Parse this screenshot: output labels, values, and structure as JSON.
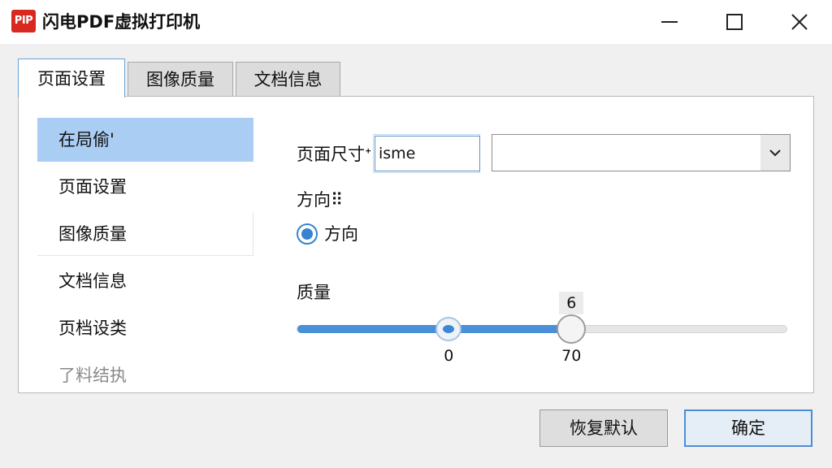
{
  "app": {
    "icon_text": "PIP",
    "title": "闪电PDF虚拟打印机",
    "brand_color": "#d8281f"
  },
  "window_controls": [
    "minimize-icon",
    "maximize-icon",
    "close-icon"
  ],
  "tabs": [
    {
      "label": "页面设置",
      "active": true
    },
    {
      "label": "图像质量",
      "active": false
    },
    {
      "label": "文档信息",
      "active": false
    }
  ],
  "sidebar": {
    "items": [
      {
        "label": "在局偷'",
        "selected": true
      },
      {
        "label": "页面设置"
      },
      {
        "label": "图像质量"
      },
      {
        "label": "文档信息"
      },
      {
        "label": "页档设类"
      },
      {
        "label": "了料结执"
      }
    ]
  },
  "form": {
    "page_size_label": "页面尺寸ᐩ",
    "page_size_value": "isme",
    "dropdown_value": "",
    "orientation_label": "方向⠿",
    "radio_label": "方向",
    "radio_checked": true,
    "quality_label": "质量",
    "slider": {
      "tooltip": "6",
      "low_label": "0",
      "high_label": "70",
      "low_fraction": 0.31,
      "high_fraction": 0.56,
      "accent_color": "#4a90d9"
    }
  },
  "buttons": {
    "reset_label": "恢复默认",
    "ok_label": "确定"
  }
}
